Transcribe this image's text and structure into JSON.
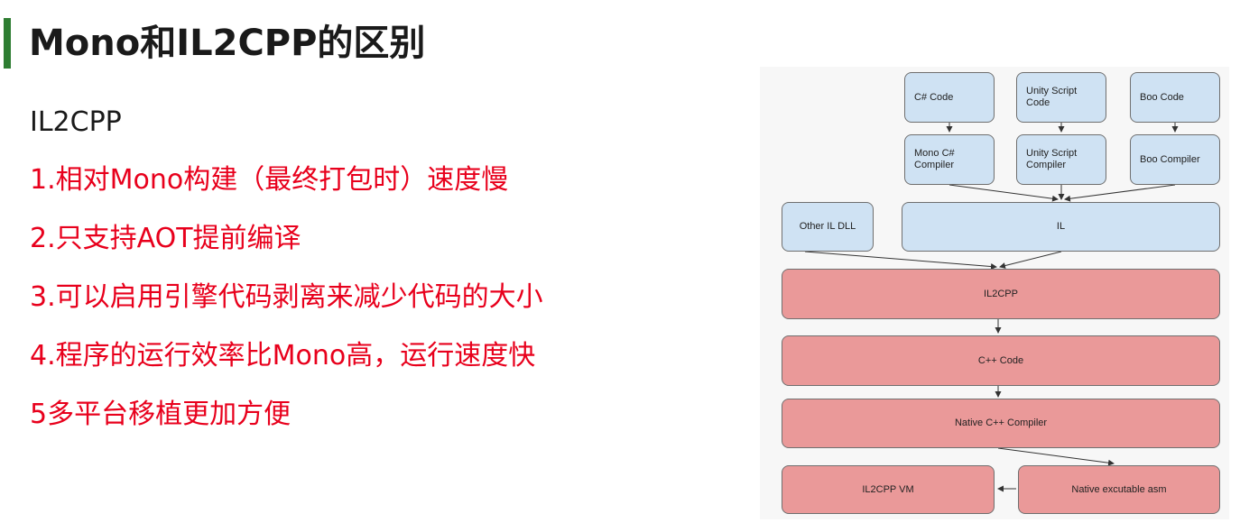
{
  "slide": {
    "title": "Mono和IL2CPP的区别",
    "subtitle": "IL2CPP",
    "points": [
      "1.相对Mono构建（最终打包时）速度慢",
      "2.只支持AOT提前编译",
      "3.可以启用引擎代码剥离来减少代码的大小",
      "4.程序的运行效率比Mono高，运行速度快",
      "5多平台移植更加方便"
    ]
  },
  "diagram": {
    "colors": {
      "managed": "#cfe2f3",
      "native": "#ea9999",
      "border": "#6f6f6f"
    },
    "nodes": {
      "csharp_code": "C# Code",
      "unityscript_code": "Unity Script\nCode",
      "boo_code": "Boo Code",
      "mono_csharp_compiler": "Mono C#\nCompiler",
      "unityscript_compiler": "Unity Script\nCompiler",
      "boo_compiler": "Boo Compiler",
      "other_il_dll": "Other IL DLL",
      "il": "IL",
      "il2cpp": "IL2CPP",
      "cpp_code": "C++ Code",
      "native_cpp_compiler": "Native C++ Compiler",
      "il2cpp_vm": "IL2CPP VM",
      "native_asm": "Native excutable asm"
    }
  }
}
